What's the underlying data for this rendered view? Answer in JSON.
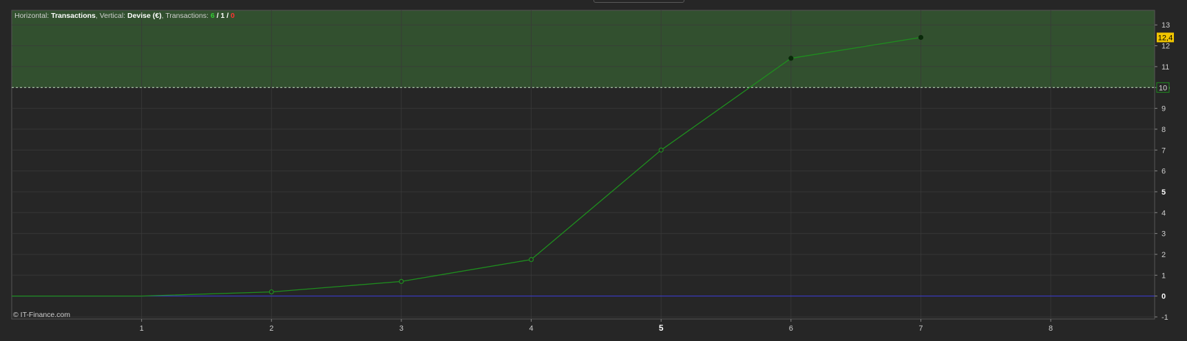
{
  "header": {
    "prefix_h": "Horizontal: ",
    "h_label": "Transactions",
    "prefix_v": ", Vertical: ",
    "v_label": "Devise (€)",
    "prefix_t": ", Transactions: ",
    "count_green": "6",
    "sep1": " / ",
    "count_white": "1",
    "sep2": " / ",
    "count_red": "0"
  },
  "copyright": "© IT-Finance.com",
  "colors": {
    "background": "#262626",
    "target_zone": "#32502f",
    "line": "#1e8f1e",
    "baseline": "#3b3bdc",
    "last_value_badge": "#f0c400",
    "grid": "#3a3a3a"
  },
  "chart_data": {
    "type": "line",
    "title": "",
    "xlabel": "",
    "ylabel": "",
    "x_ticks": [
      "1",
      "2",
      "3",
      "4",
      "5",
      "6",
      "7",
      "8"
    ],
    "y_ticks": [
      "-1",
      "0",
      "1",
      "2",
      "3",
      "4",
      "5",
      "6",
      "7",
      "8",
      "9",
      "10",
      "11",
      "12",
      "13"
    ],
    "xlim": [
      0,
      8.8
    ],
    "ylim": [
      -1.1,
      13.7
    ],
    "target_level": 10,
    "target_label": "10",
    "last_value_label": "12,4",
    "series": [
      {
        "x": [
          0,
          1,
          2,
          3,
          4,
          5,
          6,
          7
        ],
        "y": [
          0,
          0,
          0.2,
          0.7,
          1.75,
          7.0,
          11.4,
          12.4
        ]
      }
    ],
    "grid": true
  }
}
